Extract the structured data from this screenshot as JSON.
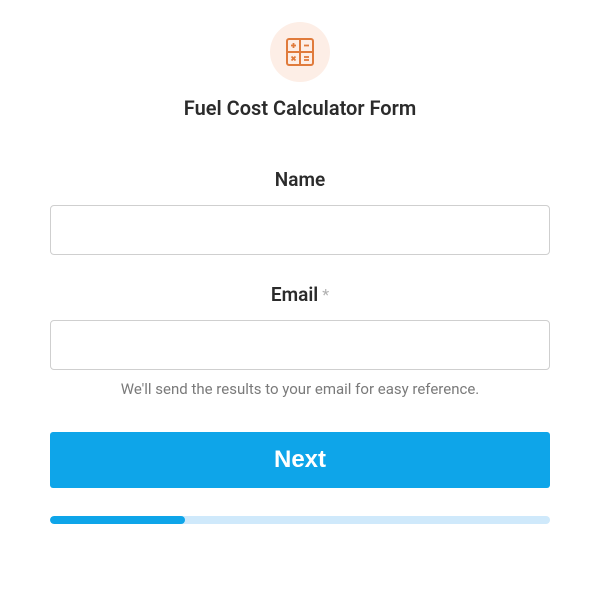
{
  "form": {
    "title": "Fuel Cost Calculator Form",
    "fields": {
      "name": {
        "label": "Name",
        "value": "",
        "required": false
      },
      "email": {
        "label": "Email",
        "value": "",
        "required": true,
        "required_mark": "*",
        "helper": "We'll send the results to your email for easy reference."
      }
    },
    "button_label": "Next",
    "progress_percent": 27
  },
  "icon": {
    "name": "calculator-icon",
    "color": "#e07b3c"
  }
}
